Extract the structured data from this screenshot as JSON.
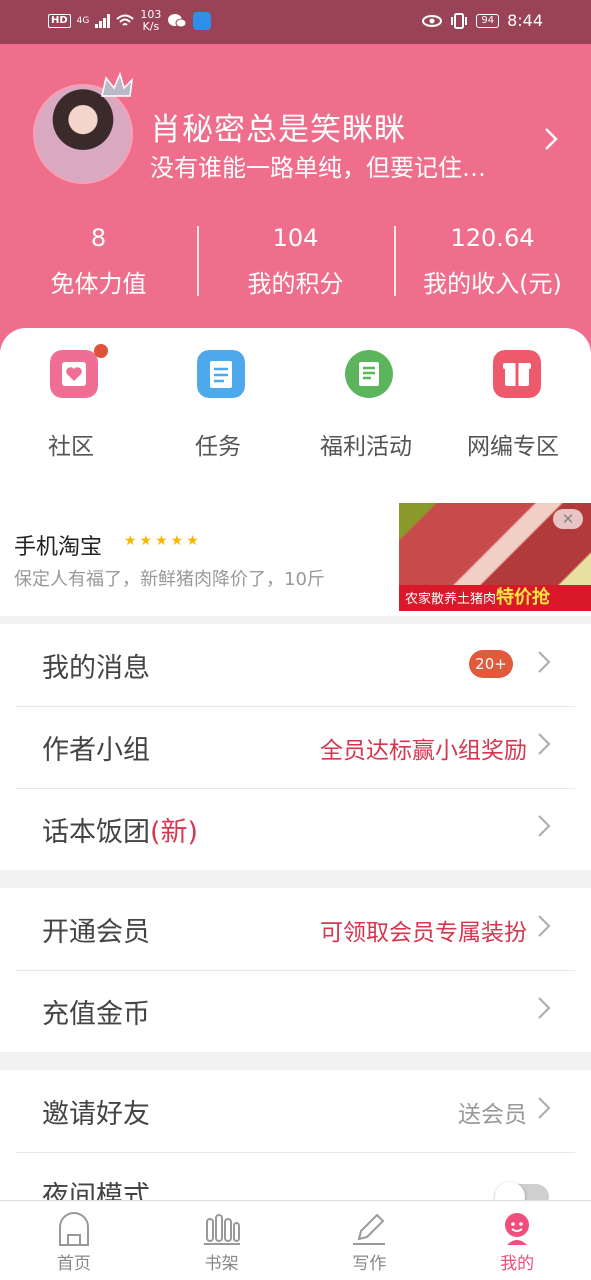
{
  "status_bar": {
    "hd": "HD",
    "net": "4G",
    "speed_value": "103",
    "speed_unit": "K/s",
    "battery": "94",
    "time": "8:44"
  },
  "profile": {
    "name": "肖秘密总是笑眯眯",
    "motto": "没有谁能一路单纯，但要记住…",
    "stats": [
      {
        "value": "8",
        "label": "免体力值"
      },
      {
        "value": "104",
        "label": "我的积分"
      },
      {
        "value": "120.64",
        "label": "我的收入(元)"
      }
    ]
  },
  "quick_actions": [
    {
      "label": "社区",
      "icon": "community-icon",
      "color": "#f06e94",
      "has_dot": true
    },
    {
      "label": "任务",
      "icon": "task-clipboard-icon",
      "color": "#4ea8ec",
      "has_dot": false
    },
    {
      "label": "福利活动",
      "icon": "welfare-news-icon",
      "color": "#5cb55c",
      "has_dot": false
    },
    {
      "label": "网编专区",
      "icon": "gift-box-icon",
      "color": "#ee5a6b",
      "has_dot": false
    }
  ],
  "ad": {
    "title": "手机淘宝",
    "stars": "★★★★★",
    "description": "保定人有福了，新鲜猪肉降价了，10斤",
    "band_text": "农家散养土猪肉",
    "band_highlight": "特价抢"
  },
  "menu": {
    "section1": [
      {
        "label": "我的消息",
        "badge": "20+"
      },
      {
        "label": "作者小组",
        "hint": "全员达标赢小组奖励"
      },
      {
        "label": "话本饭团",
        "label_tag": "(新)"
      }
    ],
    "section2": [
      {
        "label": "开通会员",
        "hint": "可领取会员专属装扮"
      },
      {
        "label": "充值金币"
      }
    ],
    "section3": [
      {
        "label": "邀请好友",
        "hint": "送会员"
      },
      {
        "label": "夜间模式",
        "toggle_on": false
      }
    ]
  },
  "tabbar": [
    {
      "label": "首页",
      "icon": "home-icon"
    },
    {
      "label": "书架",
      "icon": "bookshelf-icon"
    },
    {
      "label": "写作",
      "icon": "pen-icon"
    },
    {
      "label": "我的",
      "icon": "profile-icon",
      "active": true
    }
  ],
  "colors": {
    "header": "#ef6e8c",
    "status_bar": "#9b4356",
    "accent_red": "#d6364f",
    "badge": "#e25a3c",
    "tab_active": "#ef4f7c"
  }
}
